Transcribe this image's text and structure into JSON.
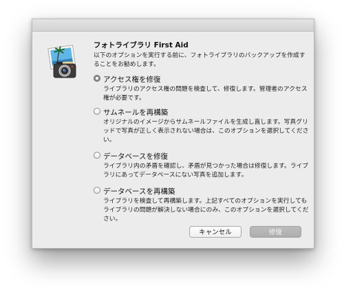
{
  "dialog": {
    "title": "フォトライブラリ First Aid",
    "intro": "以下のオプションを実行する前に、フォトライブラリのバックアップを作成することをお勧めします。",
    "icon": "photos-camera-app-icon"
  },
  "options": [
    {
      "label": "アクセス権を修復",
      "description": "ライブラリのアクセス権の問題を検査して、修復します。管理者のアクセス権が必要です。",
      "selected": true
    },
    {
      "label": "サムネールを再構築",
      "description": "オリジナルのイメージからサムネールファイルを生成し直します。写真グリッドで写真が正しく表示されない場合は、このオプションを選択してください。",
      "selected": false
    },
    {
      "label": "データベースを修復",
      "description": "ライブラリ内の矛盾を確認し、矛盾が見つかった場合は修復します。ライブラリにあってデータベースにない写真を追加します。",
      "selected": false
    },
    {
      "label": "データベースを再構築",
      "description": "ライブラリを検査して再構築します。上記すべてのオプションを実行してもライブラリの問題が解決しない場合にのみ、このオプションを選択してください。",
      "selected": false
    }
  ],
  "buttons": {
    "cancel": "キャンセル",
    "repair": "修復",
    "repair_enabled": false
  }
}
